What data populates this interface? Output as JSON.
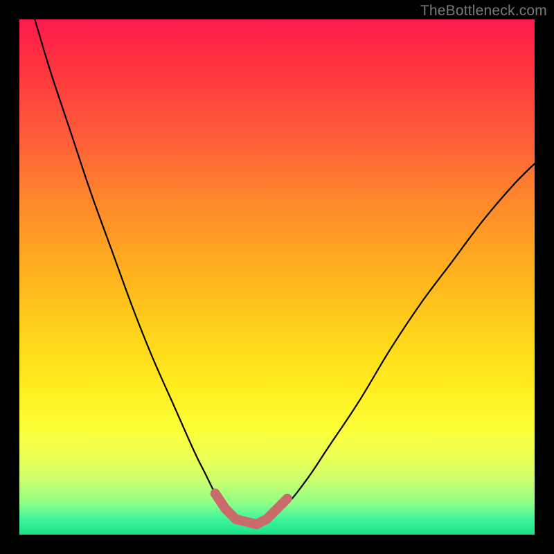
{
  "watermark": "TheBottleneck.com",
  "colors": {
    "page_bg": "#000000",
    "curve_stroke": "#000000",
    "marker_stroke": "#c96b6b",
    "gradient_top": "#ff1a4d",
    "gradient_bottom": "#17e38a"
  },
  "chart_data": {
    "type": "line",
    "title": "",
    "xlabel": "",
    "ylabel": "",
    "xlim": [
      0,
      100
    ],
    "ylim": [
      0,
      100
    ],
    "grid": false,
    "legend": false,
    "series": [
      {
        "name": "bottleneck-curve",
        "x": [
          3,
          6,
          10,
          14,
          18,
          22,
          26,
          30,
          34,
          36,
          38,
          40,
          42,
          44,
          46,
          48,
          52,
          56,
          60,
          66,
          72,
          78,
          84,
          90,
          96,
          100
        ],
        "y": [
          100,
          90,
          78,
          66,
          55,
          44,
          34,
          25,
          16,
          12,
          8,
          5,
          3,
          2,
          2,
          3,
          6,
          11,
          17,
          26,
          36,
          45,
          53,
          61,
          68,
          72
        ]
      }
    ],
    "markers": {
      "name": "highlight-band",
      "color": "#c96b6b",
      "segments": [
        {
          "x": [
            38,
            40
          ],
          "y": [
            8,
            5
          ]
        },
        {
          "x": [
            40,
            42
          ],
          "y": [
            5,
            3
          ]
        },
        {
          "x": [
            42,
            46
          ],
          "y": [
            3,
            2
          ]
        },
        {
          "x": [
            46,
            48
          ],
          "y": [
            2,
            3
          ]
        },
        {
          "x": [
            48,
            50
          ],
          "y": [
            3,
            5
          ]
        },
        {
          "x": [
            50,
            52
          ],
          "y": [
            5,
            7
          ]
        }
      ]
    }
  }
}
